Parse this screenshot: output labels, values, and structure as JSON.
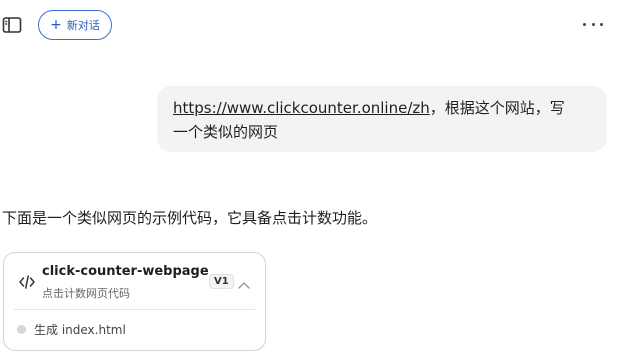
{
  "header": {
    "sidebar_toggle_icon": "sidebar-panel-icon",
    "new_chat_label": "新对话",
    "more_icon": "more-horizontal-icon"
  },
  "user_message": {
    "link_text": "https://www.clickcounter.online/zh",
    "text_line1_rest": "，根据这个网站，写",
    "text_line2": "一个类似的网页"
  },
  "assistant_message": {
    "text": "下面是一个类似网页的示例代码，它具备点击计数功能。"
  },
  "artifact_card": {
    "icon": "code-icon",
    "title": "click-counter-webpage",
    "subtitle": "点击计数网页代码",
    "version": "V1",
    "status": "生成 index.html"
  }
}
